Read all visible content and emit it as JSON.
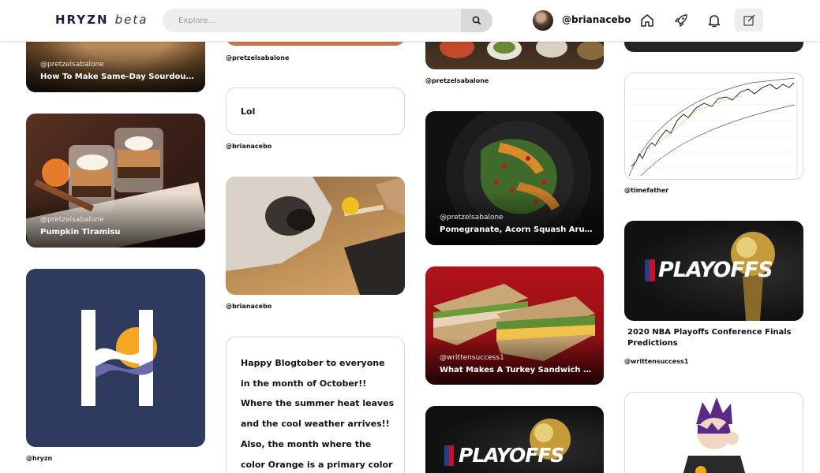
{
  "header": {
    "logo": "HRYZN",
    "logo_suffix": "beta",
    "search_placeholder": "Explore...",
    "username": "@brianacebo"
  },
  "icons": {
    "search": "search-icon",
    "home": "home-icon",
    "rocket": "rocket-icon",
    "bell": "bell-icon",
    "compose": "compose-icon"
  },
  "posts": {
    "sourdough": {
      "author": "@pretzelsabalone",
      "title": "How To Make Same-Day Sourdough ..."
    },
    "orange_card": {
      "author": "@pretzelsabalone"
    },
    "food_table": {
      "author": "@pretzelsabalone"
    },
    "lol": {
      "text": "Lol",
      "author": "@brianacebo"
    },
    "chart": {
      "author": "@timefather"
    },
    "tiramisu": {
      "author": "@pretzelsabalone",
      "title": "Pumpkin Tiramisu"
    },
    "dog": {
      "author": "@brianacebo"
    },
    "salad": {
      "author": "@pretzelsabalone",
      "title": "Pomegranate, Acorn Squash Arugul..."
    },
    "hryzn": {
      "author": "@hryzn"
    },
    "playoffs": {
      "image_text": "PLAYOFFS",
      "title": "2020 NBA Playoffs Conference Finals Predictions",
      "author": "@writtensuccess1"
    },
    "sandwich": {
      "author": "@writtensuccess1",
      "title": "What Makes A Turkey Sandwich Gre..."
    },
    "blogtober": {
      "text": "Happy Blogtober to everyone in the month of October!! Where the summer heat leaves and the cool weather arrives!! Also, the month where the color Orange is a primary color for majority of"
    },
    "playoffs2": {
      "image_text": "PLAYOFFS"
    }
  },
  "colors": {
    "brand_navy": "#2f3a5f",
    "accent_orange": "#f5a623",
    "search_bg": "#eeeeee"
  }
}
